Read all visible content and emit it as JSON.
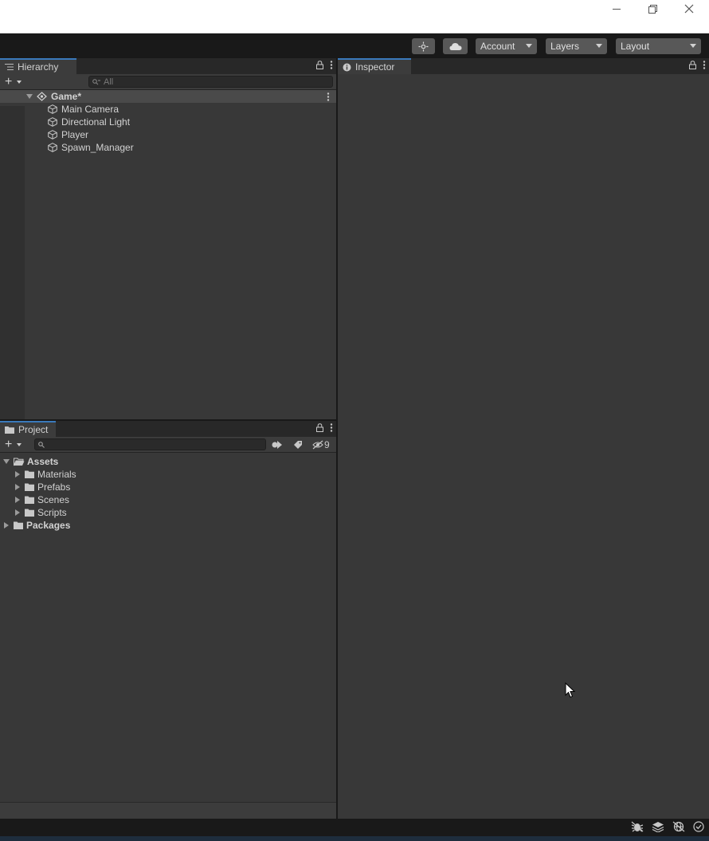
{
  "hierarchy": {
    "tab_label": "Hierarchy",
    "search_placeholder": "All",
    "scene": "Game*",
    "objects": [
      "Main Camera",
      "Directional Light",
      "Player",
      "Spawn_Manager"
    ]
  },
  "toolbar": {
    "account_label": "Account",
    "layers_label": "Layers",
    "layout_label": "Layout"
  },
  "inspector": {
    "tab_label": "Inspector"
  },
  "project": {
    "tab_label": "Project",
    "hidden_count": "9",
    "root": "Assets",
    "folders": [
      "Materials",
      "Prefabs",
      "Scenes",
      "Scripts"
    ],
    "packages": "Packages"
  },
  "icons": [
    "minimize-icon",
    "restore-icon",
    "close-icon",
    "services-icon",
    "cloud-icon",
    "lock-icon",
    "kebab-menu-icon",
    "plus-icon",
    "search-icon",
    "scene-icon",
    "gameobject-icon",
    "folder-icon",
    "filter-type-icon",
    "filter-label-icon",
    "hidden-eye-icon",
    "info-icon",
    "bug-icon",
    "layers-icon",
    "network-icon",
    "checkmark-icon",
    "mouse-cursor-icon"
  ],
  "colors": {
    "panel": "#383838",
    "tabbar": "#282828",
    "accent": "#3a79bb",
    "toolbar": "#191919"
  }
}
